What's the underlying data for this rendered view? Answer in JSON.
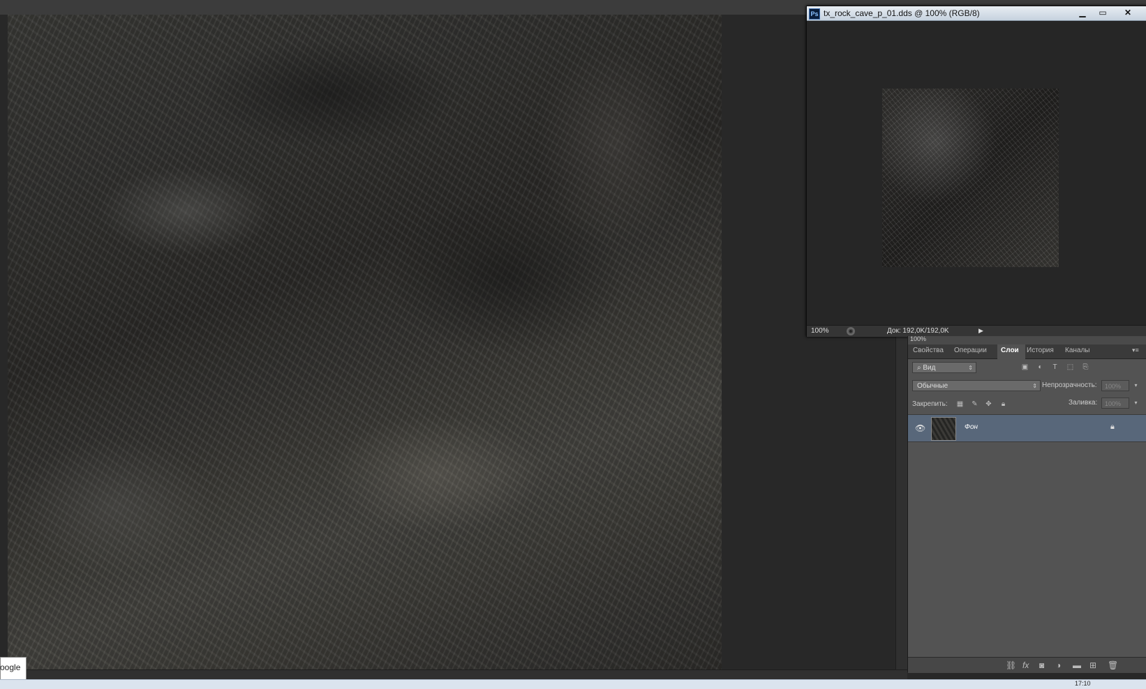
{
  "document": {
    "title": "tx_rock_cave_p_01.dds @ 100% (RGB/8)",
    "app_icon": "Ps",
    "zoom": "100%",
    "doc_info": "Док: 192,0K/192,0K",
    "window_buttons": {
      "minimize": "▁",
      "maximize": "▭",
      "close": "✕"
    }
  },
  "navigator": {
    "zoom": "100%"
  },
  "panel": {
    "tabs": [
      {
        "label": "Свойства",
        "active": false
      },
      {
        "label": "Операции",
        "active": false
      },
      {
        "label": "Слои",
        "active": true
      },
      {
        "label": "История",
        "active": false
      },
      {
        "label": "Каналы",
        "active": false
      }
    ],
    "filter_kind": "Вид",
    "blend_mode": "Обычные",
    "opacity_label": "Непрозрачность:",
    "opacity_value": "100%",
    "lock_label": "Закрепить:",
    "fill_label": "Заливка:",
    "fill_value": "100%",
    "layers": [
      {
        "name": "Фон",
        "visible": true,
        "locked": true,
        "selected": true
      }
    ]
  },
  "taskbar": {
    "clock": "17:10"
  },
  "popup": {
    "text": "oogle"
  },
  "colors": {
    "workspace_bg": "#282828",
    "panel_bg": "#535353",
    "selected_layer": "#58677a",
    "title_bar": "#dce4ed"
  }
}
